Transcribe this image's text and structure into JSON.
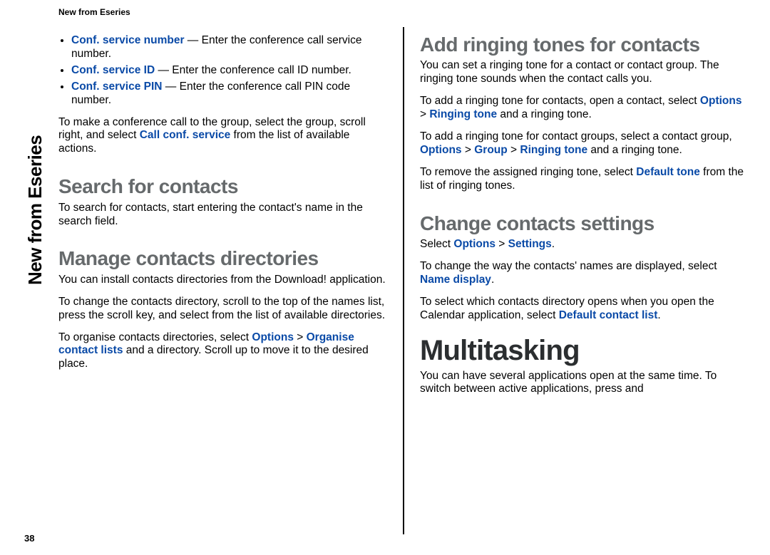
{
  "running_head": "New from Eseries",
  "sidebar_label": "New from Eseries",
  "page_number": "38",
  "left": {
    "bullets": [
      {
        "term": "Conf. service number",
        "desc": " — Enter the conference call service number."
      },
      {
        "term": "Conf. service ID",
        "desc": " — Enter the conference call ID number."
      },
      {
        "term": "Conf. service PIN",
        "desc": " — Enter the conference call PIN code number."
      }
    ],
    "conf_para_pre": "To make a conference call to the group, select the group, scroll right, and select ",
    "conf_para_hi": "Call conf. service",
    "conf_para_post": " from the list of available actions.",
    "search_heading": "Search for contacts",
    "search_para": "To search for contacts, start entering the contact's name in the search field.",
    "manage_heading": "Manage contacts directories",
    "manage_p1": "You can install contacts directories from the Download! application.",
    "manage_p2": "To change the contacts directory, scroll to the top of the names list, press the scroll key, and select from the list of available directories.",
    "manage_p3_pre": "To organise contacts directories, select ",
    "manage_p3_hi1": "Options",
    "manage_p3_gt": "  >  ",
    "manage_p3_hi2": "Organise contact lists",
    "manage_p3_post": " and a directory. Scroll up to move it to the desired place."
  },
  "right": {
    "ring_heading": "Add ringing tones for contacts",
    "ring_p1": "You can set a ringing tone for a contact or contact group. The ringing tone sounds when the contact calls you.",
    "ring_p2_pre": "To add a ringing tone for contacts, open a contact, select ",
    "ring_p2_hi1": "Options",
    "gt": "  >  ",
    "ring_p2_hi2": "Ringing tone",
    "ring_p2_post": " and a ringing tone.",
    "ring_p3_pre": "To add a ringing tone for contact groups, select a contact group, ",
    "ring_p3_hi1": "Options",
    "ring_p3_hi2": "Group",
    "ring_p3_hi3": "Ringing tone",
    "ring_p3_post": " and a ringing tone.",
    "ring_p4_pre": "To remove the assigned ringing tone, select ",
    "ring_p4_hi": "Default tone",
    "ring_p4_post": " from the list of ringing tones.",
    "change_heading": "Change contacts settings",
    "change_p1_pre": "Select ",
    "change_p1_hi1": "Options",
    "change_p1_hi2": "Settings",
    "change_p1_post": ".",
    "change_p2_pre": "To change the way the contacts' names are displayed, select ",
    "change_p2_hi": "Name display",
    "change_p2_post": ".",
    "change_p3_pre": "To select which contacts directory opens when you open the Calendar application, select ",
    "change_p3_hi": "Default contact list",
    "change_p3_post": ".",
    "multitask_heading": "Multitasking",
    "multitask_p1": "You can have several applications open at the same time. To switch between active applications, press and"
  }
}
